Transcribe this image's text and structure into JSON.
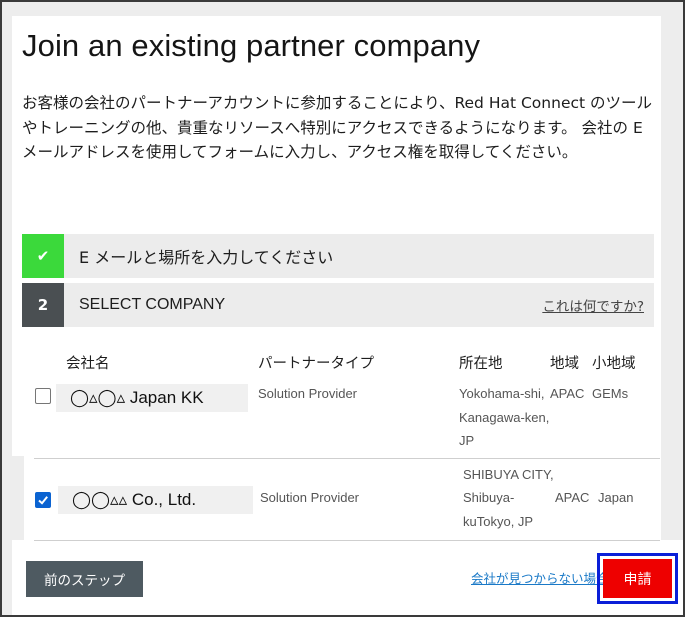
{
  "title": "Join an existing partner company",
  "intro": "お客様の会社のパートナーアカウントに参加することにより、Red Hat Connect のツールやトレーニングの他、貴重なリソースへ特別にアクセスできるようになります。 会社の E メールアドレスを使用してフォームに入力し、アクセス権を取得してください。",
  "steps": [
    {
      "marker": "✔",
      "label": "E メールと場所を入力してください",
      "status": "complete"
    },
    {
      "marker": "2",
      "label": "SELECT COMPANY",
      "help": "これは何ですか?",
      "status": "current"
    }
  ],
  "table": {
    "headers": [
      "会社名",
      "パートナータイプ",
      "所在地",
      "地域",
      "小地域"
    ],
    "rows": [
      {
        "checked": false,
        "name": "◯▵◯▵ Japan KK",
        "partner_type": "Solution Provider",
        "location": [
          "Yokohama-shi,",
          "Kanagawa-ken,",
          "JP"
        ],
        "region": "APAC",
        "subregion": "GEMs"
      },
      {
        "checked": true,
        "name": "◯◯▵▵ Co., Ltd.",
        "partner_type": "Solution Provider",
        "location": [
          "SHIBUYA CITY,",
          "Shibuya-",
          "kuTokyo, JP"
        ],
        "region": "APAC",
        "subregion": "Japan"
      }
    ]
  },
  "footer": {
    "back_label": "前のステップ",
    "not_found_link": "会社が見つからない場合",
    "submit_label": "申請"
  },
  "colors": {
    "complete": "#3bd93b",
    "current": "#4a4f52",
    "submit": "#ee0000",
    "highlight_outline": "#0a1fd8",
    "link": "#1a79c7"
  }
}
